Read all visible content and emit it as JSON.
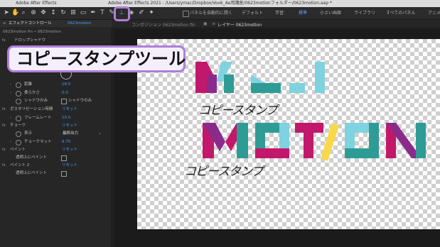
{
  "titlebar": {
    "menu_left": "Adobe After Effects",
    "title": "Adobe After Effects 2021 - /Users/ymac/Dropbox/Vook_Ae用講座/0623motionフォルダー/0623motion.aep *"
  },
  "toolbar": {
    "auto_open_label": "パネルを自動的に開く",
    "workspaces": [
      "デフォルト",
      "学習",
      "標準",
      "小さい画面",
      "ライブラリ",
      "すべてのパネル",
      "アニメ"
    ],
    "active_workspace": "標準"
  },
  "callout": {
    "text": "コピースタンプツール"
  },
  "left_panel": {
    "tab_title": "エフェクトコントロール",
    "tab_target": "0623motion",
    "breadcrumb": "0623motion fin • 0623motion",
    "rows": [
      {
        "label": "ドロップシャドウ",
        "value": ""
      },
      {
        "label": "距離",
        "value": "18.0"
      },
      {
        "label": "柔らかさ",
        "value": "0.0"
      },
      {
        "label": "シャドウのみ",
        "value": "シャドウのみ"
      },
      {
        "label": "ポスタリゼーション時間",
        "value": "リセット"
      },
      {
        "label": "フレームレート",
        "value": "10.0"
      },
      {
        "label": "チョーク",
        "value": "リセット"
      },
      {
        "label": "表示",
        "value": "最終出力"
      },
      {
        "label": "チョークマット",
        "value": "9.70"
      },
      {
        "label": "ペイント",
        "value": "リセット"
      },
      {
        "label": "透明上にペイント",
        "value": ""
      },
      {
        "label": "ペイント 2",
        "value": "リセット"
      },
      {
        "label": "透明上にペイント",
        "value": ""
      }
    ]
  },
  "viewer": {
    "comp_tab": "コンポジション 0623motion fin",
    "layer_tab": "レイヤー 0623motion"
  },
  "artwork": {
    "word": "MOTION",
    "stamp_text": "コピースタンプ",
    "colors": {
      "magenta": "#c2186b",
      "teal": "#2e9c95",
      "cyan": "#7fd3e0",
      "yellow": "#f9d84a",
      "purple": "#8a2b8c"
    }
  }
}
